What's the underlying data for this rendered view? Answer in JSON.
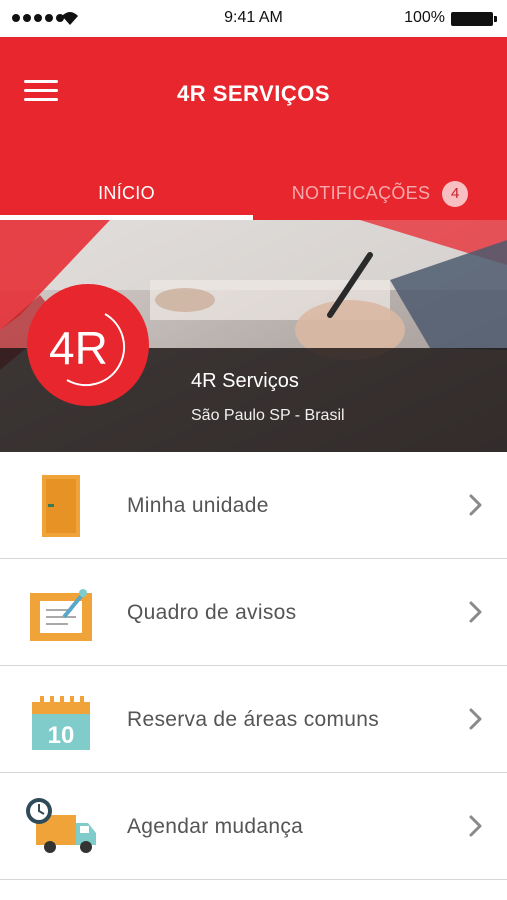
{
  "status_bar": {
    "time": "9:41 AM",
    "battery": "100%",
    "signal_icon": "signal-dots-icon",
    "wifi_icon": "wifi-icon",
    "battery_icon": "battery-icon"
  },
  "header": {
    "title": "4R SERVIÇOS",
    "menu_icon": "hamburger-menu-icon",
    "color": "#e8262e"
  },
  "tabs": [
    {
      "label": "INÍCIO",
      "active": true
    },
    {
      "label": "NOTIFICAÇÕES",
      "badge": "4",
      "active": false
    }
  ],
  "banner": {
    "logo_text": "4R",
    "company_name": "4R Serviços",
    "location": "São Paulo SP - Brasil"
  },
  "menu_items": [
    {
      "label": "Minha unidade",
      "icon": "door-icon"
    },
    {
      "label": "Quadro de avisos",
      "icon": "notice-board-icon"
    },
    {
      "label": "Reserva de áreas comuns",
      "icon": "calendar-icon",
      "icon_text": "10"
    },
    {
      "label": "Agendar mudança",
      "icon": "moving-truck-icon"
    }
  ],
  "colors": {
    "brand_red": "#e8262e",
    "icon_orange": "#f0a339",
    "icon_teal": "#7fcccb",
    "text_gray": "#555555"
  }
}
